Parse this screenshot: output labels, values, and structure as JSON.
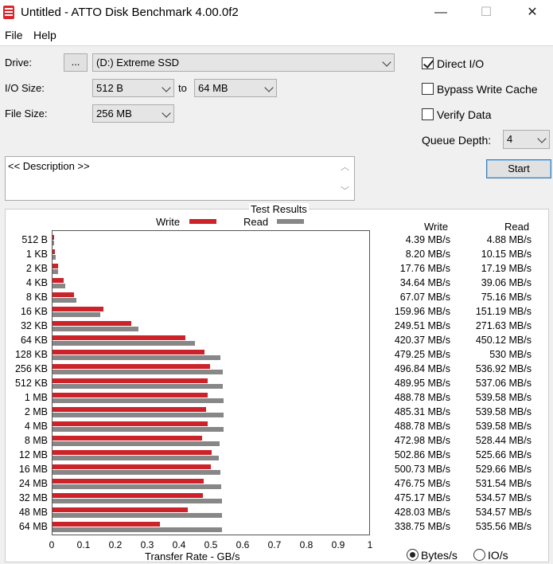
{
  "window": {
    "title": "Untitled - ATTO Disk Benchmark 4.00.0f2",
    "minimize": "—",
    "maximize": "☐",
    "close": "✕"
  },
  "menu": {
    "file": "File",
    "help": "Help"
  },
  "form": {
    "drive_label": "Drive:",
    "browse_label": "...",
    "drive_value": "(D:) Extreme SSD",
    "io_size_label": "I/O Size:",
    "io_from": "512 B",
    "to_label": "to",
    "io_to": "64 MB",
    "file_size_label": "File Size:",
    "file_size": "256 MB",
    "direct_io": "Direct I/O",
    "bypass_write_cache": "Bypass Write Cache",
    "verify_data": "Verify Data",
    "queue_depth_label": "Queue Depth:",
    "queue_depth": "4",
    "start": "Start",
    "description_placeholder": "<< Description >>"
  },
  "checks": {
    "direct_io": true,
    "bypass_write_cache": false,
    "verify_data": false
  },
  "results": {
    "title": "Test Results",
    "write_legend": "Write",
    "read_legend": "Read",
    "write_header": "Write",
    "read_header": "Read"
  },
  "units": {
    "bytes": "Bytes/s",
    "io": "IO/s",
    "selected": "bytes"
  },
  "colors": {
    "write": "#cc2229",
    "read": "#878787"
  },
  "chart_data": {
    "type": "bar",
    "orientation": "horizontal",
    "xlabel": "Transfer Rate - GB/s",
    "xlim": [
      0,
      1
    ],
    "xticks": [
      "0",
      "0.1",
      "0.2",
      "0.3",
      "0.4",
      "0.5",
      "0.6",
      "0.7",
      "0.8",
      "0.9",
      "1"
    ],
    "categories": [
      "512 B",
      "1 KB",
      "2 KB",
      "4 KB",
      "8 KB",
      "16 KB",
      "32 KB",
      "64 KB",
      "128 KB",
      "256 KB",
      "512 KB",
      "1 MB",
      "2 MB",
      "4 MB",
      "8 MB",
      "12 MB",
      "16 MB",
      "24 MB",
      "32 MB",
      "48 MB",
      "64 MB"
    ],
    "series": [
      {
        "name": "Write",
        "values": [
          0.00439,
          0.0082,
          0.01776,
          0.03464,
          0.06707,
          0.15996,
          0.24951,
          0.42037,
          0.47925,
          0.49684,
          0.48995,
          0.48878,
          0.48531,
          0.48878,
          0.47298,
          0.50286,
          0.50073,
          0.47675,
          0.47517,
          0.42803,
          0.33875
        ]
      },
      {
        "name": "Read",
        "values": [
          0.00488,
          0.01015,
          0.01719,
          0.03906,
          0.07516,
          0.15119,
          0.27163,
          0.45012,
          0.53,
          0.53692,
          0.53706,
          0.53958,
          0.53958,
          0.53958,
          0.52844,
          0.52566,
          0.52966,
          0.53154,
          0.53457,
          0.53457,
          0.53556
        ]
      }
    ],
    "write_text": [
      "4.39 MB/s",
      "8.20 MB/s",
      "17.76 MB/s",
      "34.64 MB/s",
      "67.07 MB/s",
      "159.96 MB/s",
      "249.51 MB/s",
      "420.37 MB/s",
      "479.25 MB/s",
      "496.84 MB/s",
      "489.95 MB/s",
      "488.78 MB/s",
      "485.31 MB/s",
      "488.78 MB/s",
      "472.98 MB/s",
      "502.86 MB/s",
      "500.73 MB/s",
      "476.75 MB/s",
      "475.17 MB/s",
      "428.03 MB/s",
      "338.75 MB/s"
    ],
    "read_text": [
      "4.88 MB/s",
      "10.15 MB/s",
      "17.19 MB/s",
      "39.06 MB/s",
      "75.16 MB/s",
      "151.19 MB/s",
      "271.63 MB/s",
      "450.12 MB/s",
      "530 MB/s",
      "536.92 MB/s",
      "537.06 MB/s",
      "539.58 MB/s",
      "539.58 MB/s",
      "539.58 MB/s",
      "528.44 MB/s",
      "525.66 MB/s",
      "529.66 MB/s",
      "531.54 MB/s",
      "534.57 MB/s",
      "534.57 MB/s",
      "535.56 MB/s"
    ]
  }
}
